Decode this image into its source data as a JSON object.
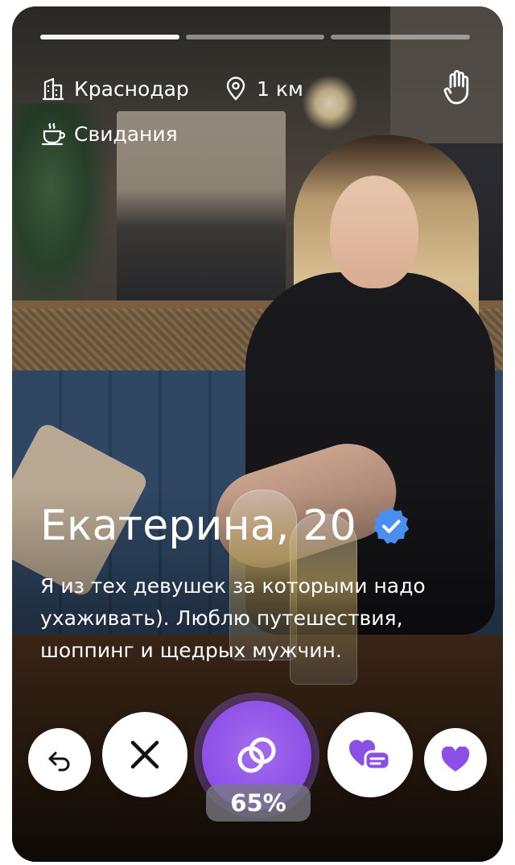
{
  "progress": {
    "total": 3,
    "active_index": 0
  },
  "header": {
    "city": "Краснодар",
    "distance": "1 км",
    "purpose": "Свидания"
  },
  "profile": {
    "name_age": "Екатерина, 20",
    "verified": true,
    "bio": "Я из тех девушек за которыми надо ухаживать). Люблю путешествия, шоппинг и щедрых мужчин."
  },
  "actions": {
    "undo_icon": "undo-icon",
    "dislike_icon": "close-icon",
    "match_icon": "rings-icon",
    "match_percent": "65%",
    "superlike_icon": "heart-message-icon",
    "like_icon": "heart-icon"
  },
  "colors": {
    "accent": "#8b4fe6",
    "verified": "#4a8ff0"
  }
}
